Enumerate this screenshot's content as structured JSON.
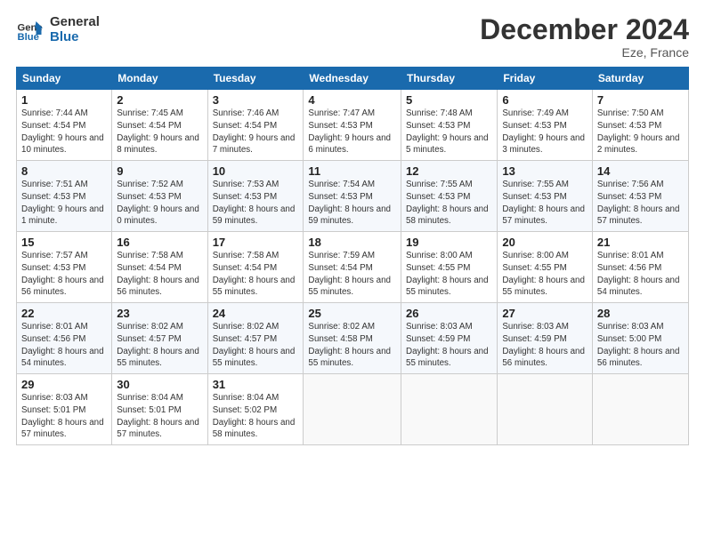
{
  "header": {
    "logo_line1": "General",
    "logo_line2": "Blue",
    "month_title": "December 2024",
    "location": "Eze, France"
  },
  "weekdays": [
    "Sunday",
    "Monday",
    "Tuesday",
    "Wednesday",
    "Thursday",
    "Friday",
    "Saturday"
  ],
  "weeks": [
    [
      {
        "day": "1",
        "sunrise": "7:44 AM",
        "sunset": "4:54 PM",
        "daylight": "9 hours and 10 minutes."
      },
      {
        "day": "2",
        "sunrise": "7:45 AM",
        "sunset": "4:54 PM",
        "daylight": "9 hours and 8 minutes."
      },
      {
        "day": "3",
        "sunrise": "7:46 AM",
        "sunset": "4:54 PM",
        "daylight": "9 hours and 7 minutes."
      },
      {
        "day": "4",
        "sunrise": "7:47 AM",
        "sunset": "4:53 PM",
        "daylight": "9 hours and 6 minutes."
      },
      {
        "day": "5",
        "sunrise": "7:48 AM",
        "sunset": "4:53 PM",
        "daylight": "9 hours and 5 minutes."
      },
      {
        "day": "6",
        "sunrise": "7:49 AM",
        "sunset": "4:53 PM",
        "daylight": "9 hours and 3 minutes."
      },
      {
        "day": "7",
        "sunrise": "7:50 AM",
        "sunset": "4:53 PM",
        "daylight": "9 hours and 2 minutes."
      }
    ],
    [
      {
        "day": "8",
        "sunrise": "7:51 AM",
        "sunset": "4:53 PM",
        "daylight": "9 hours and 1 minute."
      },
      {
        "day": "9",
        "sunrise": "7:52 AM",
        "sunset": "4:53 PM",
        "daylight": "9 hours and 0 minutes."
      },
      {
        "day": "10",
        "sunrise": "7:53 AM",
        "sunset": "4:53 PM",
        "daylight": "8 hours and 59 minutes."
      },
      {
        "day": "11",
        "sunrise": "7:54 AM",
        "sunset": "4:53 PM",
        "daylight": "8 hours and 59 minutes."
      },
      {
        "day": "12",
        "sunrise": "7:55 AM",
        "sunset": "4:53 PM",
        "daylight": "8 hours and 58 minutes."
      },
      {
        "day": "13",
        "sunrise": "7:55 AM",
        "sunset": "4:53 PM",
        "daylight": "8 hours and 57 minutes."
      },
      {
        "day": "14",
        "sunrise": "7:56 AM",
        "sunset": "4:53 PM",
        "daylight": "8 hours and 57 minutes."
      }
    ],
    [
      {
        "day": "15",
        "sunrise": "7:57 AM",
        "sunset": "4:53 PM",
        "daylight": "8 hours and 56 minutes."
      },
      {
        "day": "16",
        "sunrise": "7:58 AM",
        "sunset": "4:54 PM",
        "daylight": "8 hours and 56 minutes."
      },
      {
        "day": "17",
        "sunrise": "7:58 AM",
        "sunset": "4:54 PM",
        "daylight": "8 hours and 55 minutes."
      },
      {
        "day": "18",
        "sunrise": "7:59 AM",
        "sunset": "4:54 PM",
        "daylight": "8 hours and 55 minutes."
      },
      {
        "day": "19",
        "sunrise": "8:00 AM",
        "sunset": "4:55 PM",
        "daylight": "8 hours and 55 minutes."
      },
      {
        "day": "20",
        "sunrise": "8:00 AM",
        "sunset": "4:55 PM",
        "daylight": "8 hours and 55 minutes."
      },
      {
        "day": "21",
        "sunrise": "8:01 AM",
        "sunset": "4:56 PM",
        "daylight": "8 hours and 54 minutes."
      }
    ],
    [
      {
        "day": "22",
        "sunrise": "8:01 AM",
        "sunset": "4:56 PM",
        "daylight": "8 hours and 54 minutes."
      },
      {
        "day": "23",
        "sunrise": "8:02 AM",
        "sunset": "4:57 PM",
        "daylight": "8 hours and 55 minutes."
      },
      {
        "day": "24",
        "sunrise": "8:02 AM",
        "sunset": "4:57 PM",
        "daylight": "8 hours and 55 minutes."
      },
      {
        "day": "25",
        "sunrise": "8:02 AM",
        "sunset": "4:58 PM",
        "daylight": "8 hours and 55 minutes."
      },
      {
        "day": "26",
        "sunrise": "8:03 AM",
        "sunset": "4:59 PM",
        "daylight": "8 hours and 55 minutes."
      },
      {
        "day": "27",
        "sunrise": "8:03 AM",
        "sunset": "4:59 PM",
        "daylight": "8 hours and 56 minutes."
      },
      {
        "day": "28",
        "sunrise": "8:03 AM",
        "sunset": "5:00 PM",
        "daylight": "8 hours and 56 minutes."
      }
    ],
    [
      {
        "day": "29",
        "sunrise": "8:03 AM",
        "sunset": "5:01 PM",
        "daylight": "8 hours and 57 minutes."
      },
      {
        "day": "30",
        "sunrise": "8:04 AM",
        "sunset": "5:01 PM",
        "daylight": "8 hours and 57 minutes."
      },
      {
        "day": "31",
        "sunrise": "8:04 AM",
        "sunset": "5:02 PM",
        "daylight": "8 hours and 58 minutes."
      },
      null,
      null,
      null,
      null
    ]
  ],
  "labels": {
    "sunrise": "Sunrise:",
    "sunset": "Sunset:",
    "daylight": "Daylight:"
  }
}
